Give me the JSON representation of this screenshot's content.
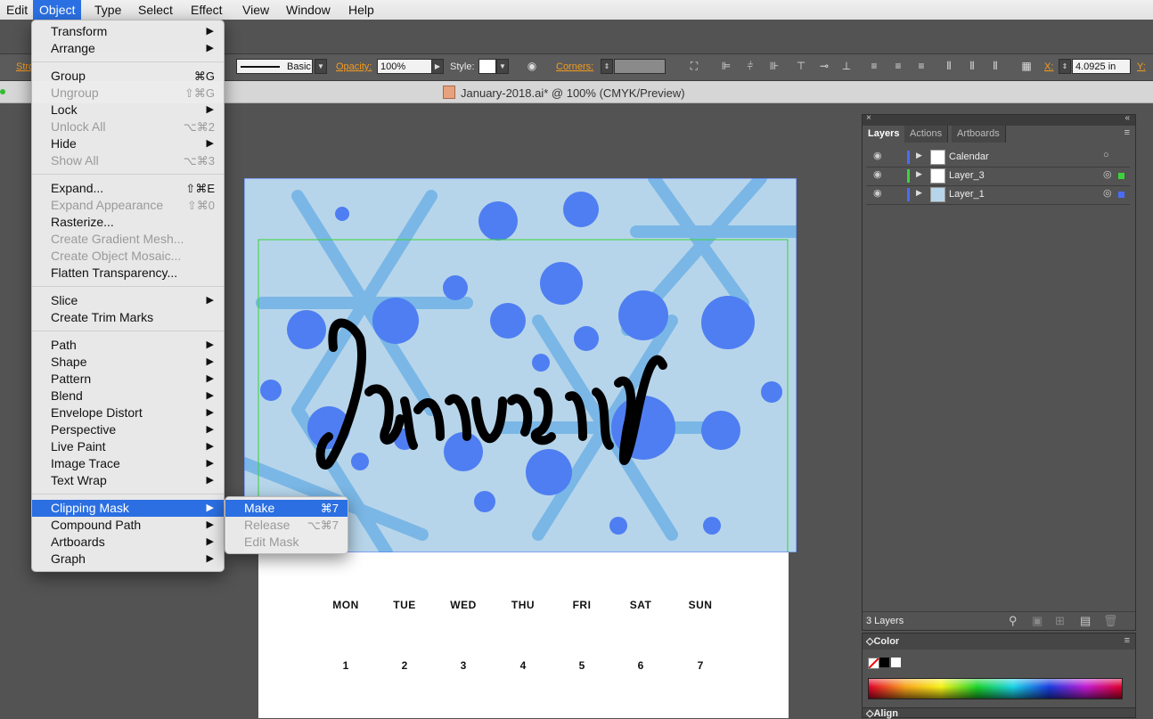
{
  "menubar": {
    "items": [
      {
        "label": "Edit"
      },
      {
        "label": "Object"
      },
      {
        "label": "Type"
      },
      {
        "label": "Select"
      },
      {
        "label": "Effect"
      },
      {
        "label": "View"
      },
      {
        "label": "Window"
      },
      {
        "label": "Help"
      }
    ]
  },
  "controlbar": {
    "stroke_label": "Stro",
    "brush_label": "Basic",
    "opacity_label": "Opacity:",
    "opacity_value": "100%",
    "style_label": "Style:",
    "corners_label": "Corners:",
    "x_label": "X:",
    "x_value": "4.0925 in",
    "y_label": "Y:"
  },
  "document": {
    "tab_title": "January-2018.ai* @ 100% (CMYK/Preview)"
  },
  "calendar": {
    "weekdays": [
      "MON",
      "TUE",
      "WED",
      "THU",
      "FRI",
      "SAT",
      "SUN"
    ],
    "dates": [
      "1",
      "2",
      "3",
      "4",
      "5",
      "6",
      "7"
    ]
  },
  "object_menu": {
    "items": [
      {
        "label": "Transform",
        "submenu": true
      },
      {
        "label": "Arrange",
        "submenu": true
      },
      {
        "label": "Group",
        "shortcut": "⌘G"
      },
      {
        "label": "Ungroup",
        "shortcut": "⇧⌘G",
        "disabled": true
      },
      {
        "label": "Lock",
        "submenu": true
      },
      {
        "label": "Unlock All",
        "shortcut": "⌥⌘2",
        "disabled": true
      },
      {
        "label": "Hide",
        "submenu": true
      },
      {
        "label": "Show All",
        "shortcut": "⌥⌘3",
        "disabled": true
      },
      {
        "label": "Expand...",
        "shortcut": "⇧⌘E"
      },
      {
        "label": "Expand Appearance",
        "shortcut": "⇧⌘0",
        "disabled": true
      },
      {
        "label": "Rasterize..."
      },
      {
        "label": "Create Gradient Mesh...",
        "disabled": true
      },
      {
        "label": "Create Object Mosaic...",
        "disabled": true
      },
      {
        "label": "Flatten Transparency..."
      },
      {
        "label": "Slice",
        "submenu": true
      },
      {
        "label": "Create Trim Marks"
      },
      {
        "label": "Path",
        "submenu": true
      },
      {
        "label": "Shape",
        "submenu": true
      },
      {
        "label": "Pattern",
        "submenu": true
      },
      {
        "label": "Blend",
        "submenu": true
      },
      {
        "label": "Envelope Distort",
        "submenu": true
      },
      {
        "label": "Perspective",
        "submenu": true
      },
      {
        "label": "Live Paint",
        "submenu": true
      },
      {
        "label": "Image Trace",
        "submenu": true
      },
      {
        "label": "Text Wrap",
        "submenu": true
      },
      {
        "label": "Clipping Mask",
        "submenu": true,
        "highlighted": true
      },
      {
        "label": "Compound Path",
        "submenu": true
      },
      {
        "label": "Artboards",
        "submenu": true
      },
      {
        "label": "Graph",
        "submenu": true
      }
    ]
  },
  "clipping_submenu": {
    "items": [
      {
        "label": "Make",
        "shortcut": "⌘7",
        "highlighted": true
      },
      {
        "label": "Release",
        "shortcut": "⌥⌘7",
        "disabled": true
      },
      {
        "label": "Edit Mask",
        "disabled": true
      }
    ]
  },
  "layers_panel": {
    "tabs": [
      "Layers",
      "Actions",
      "Artboards"
    ],
    "layers": [
      {
        "name": "Calendar",
        "color": "#4a6cf7"
      },
      {
        "name": "Layer_3",
        "color": "#3ad43a"
      },
      {
        "name": "Layer_1",
        "color": "#4a6cf7"
      }
    ],
    "footer": "3 Layers"
  },
  "color_panel": {
    "title": "Color"
  },
  "align_panel": {
    "title": "Align"
  },
  "colors": {
    "accent": "#2b6fe2",
    "selection": "#4a6cf7",
    "sky": "#b7d5ea"
  }
}
